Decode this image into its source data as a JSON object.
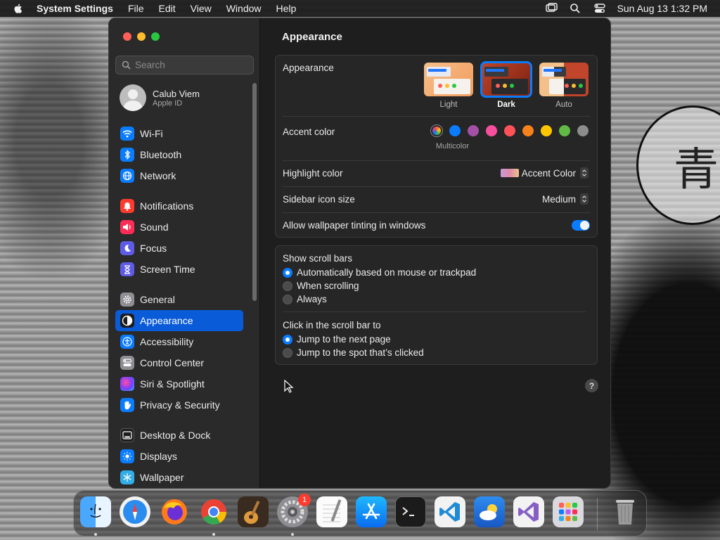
{
  "menubar": {
    "app_name": "System Settings",
    "items": [
      "File",
      "Edit",
      "View",
      "Window",
      "Help"
    ],
    "clock": "Sun Aug 13  1:32 PM"
  },
  "search": {
    "placeholder": "Search"
  },
  "user": {
    "name": "Calub Viem",
    "subtitle": "Apple ID"
  },
  "sidebar": {
    "groups": [
      [
        {
          "label": "Wi-Fi",
          "icon": "wifi-icon",
          "color": "#0a7cff"
        },
        {
          "label": "Bluetooth",
          "icon": "bluetooth-icon",
          "color": "#0a7cff"
        },
        {
          "label": "Network",
          "icon": "globe-icon",
          "color": "#0a7cff"
        }
      ],
      [
        {
          "label": "Notifications",
          "icon": "bell-icon",
          "color": "#ff3b30"
        },
        {
          "label": "Sound",
          "icon": "speaker-icon",
          "color": "#ff2d55"
        },
        {
          "label": "Focus",
          "icon": "moon-icon",
          "color": "#5e5ce6"
        },
        {
          "label": "Screen Time",
          "icon": "hourglass-icon",
          "color": "#5e5ce6"
        }
      ],
      [
        {
          "label": "General",
          "icon": "gear-icon",
          "color": "#8e8e93"
        },
        {
          "label": "Appearance",
          "icon": "appearance-icon",
          "color": "#1c1c1e",
          "active": true
        },
        {
          "label": "Accessibility",
          "icon": "accessibility-icon",
          "color": "#0a7cff"
        },
        {
          "label": "Control Center",
          "icon": "control-center-icon",
          "color": "#8e8e93"
        },
        {
          "label": "Siri & Spotlight",
          "icon": "siri-icon",
          "color": "#bf5af2"
        },
        {
          "label": "Privacy & Security",
          "icon": "hand-icon",
          "color": "#0a7cff"
        }
      ],
      [
        {
          "label": "Desktop & Dock",
          "icon": "dock-icon",
          "color": "#1c1c1e"
        },
        {
          "label": "Displays",
          "icon": "sun-icon",
          "color": "#0a7cff"
        },
        {
          "label": "Wallpaper",
          "icon": "snowflake-icon",
          "color": "#32ade6"
        }
      ]
    ]
  },
  "content": {
    "title": "Appearance",
    "appearance": {
      "label": "Appearance",
      "options": [
        {
          "label": "Light",
          "selected": false
        },
        {
          "label": "Dark",
          "selected": true
        },
        {
          "label": "Auto",
          "selected": false
        }
      ]
    },
    "accent": {
      "label": "Accent color",
      "selected_caption": "Multicolor",
      "colors": [
        "multicolor",
        "#0a7cff",
        "#a550a7",
        "#f74f9e",
        "#ff5257",
        "#f7821b",
        "#ffc600",
        "#62ba46",
        "#8c8c8c"
      ]
    },
    "highlight": {
      "label": "Highlight color",
      "value": "Accent Color"
    },
    "icon_size": {
      "label": "Sidebar icon size",
      "value": "Medium"
    },
    "tinting": {
      "label": "Allow wallpaper tinting in windows",
      "enabled": true
    },
    "scroll_bars": {
      "label": "Show scroll bars",
      "options": [
        {
          "label": "Automatically based on mouse or trackpad",
          "selected": true
        },
        {
          "label": "When scrolling",
          "selected": false
        },
        {
          "label": "Always",
          "selected": false
        }
      ]
    },
    "click_scroll": {
      "label": "Click in the scroll bar to",
      "options": [
        {
          "label": "Jump to the next page",
          "selected": true
        },
        {
          "label": "Jump to the spot that’s clicked",
          "selected": false
        }
      ]
    },
    "help": "?"
  },
  "dock": {
    "apps": [
      "Finder",
      "Safari",
      "Firefox",
      "Chrome",
      "GarageBand",
      "System Settings",
      "TextEdit",
      "App Store",
      "Terminal",
      "Visual Studio Code",
      "Weather",
      "Visual Studio",
      "Launchpad"
    ],
    "badge": "1",
    "trash": "Trash"
  }
}
